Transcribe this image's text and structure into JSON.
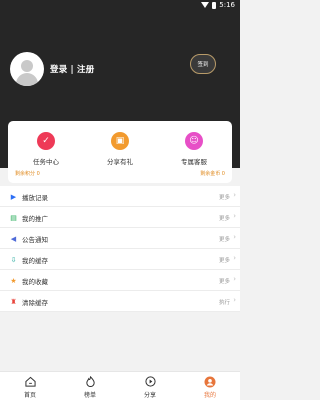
{
  "status": {
    "time": "5:16"
  },
  "header": {
    "login_text": "登录 | 注册",
    "signin_label": "签到"
  },
  "card": {
    "items": [
      {
        "label": "任务中心",
        "icon": "task-icon",
        "color": "#ee3a57"
      },
      {
        "label": "分享有礼",
        "icon": "gift-icon",
        "color": "#f29a2e"
      },
      {
        "label": "专属客服",
        "icon": "service-icon",
        "color": "#e74fc7"
      }
    ],
    "points_left": "剩余积分 0",
    "coins_left": "剩余金币 0"
  },
  "menu": [
    {
      "label": "播放记录",
      "action": "更多",
      "icon": "play-history-icon",
      "color": "#2c6ff5"
    },
    {
      "label": "我的推广",
      "action": "更多",
      "icon": "promotion-icon",
      "color": "#1aa84f"
    },
    {
      "label": "公告通知",
      "action": "更多",
      "icon": "announcement-icon",
      "color": "#4f6bd8"
    },
    {
      "label": "我的缓存",
      "action": "更多",
      "icon": "download-icon",
      "color": "#1ea79a"
    },
    {
      "label": "我的收藏",
      "action": "更多",
      "icon": "star-icon",
      "color": "#f29a2e"
    },
    {
      "label": "清除缓存",
      "action": "执行",
      "icon": "broom-icon",
      "color": "#e8453c"
    }
  ],
  "tabs": [
    {
      "label": "首页",
      "icon": "home-icon"
    },
    {
      "label": "榜单",
      "icon": "ranking-icon"
    },
    {
      "label": "分享",
      "icon": "share-icon"
    },
    {
      "label": "我的",
      "icon": "profile-icon",
      "active": true,
      "color": "#e7753b"
    }
  ]
}
